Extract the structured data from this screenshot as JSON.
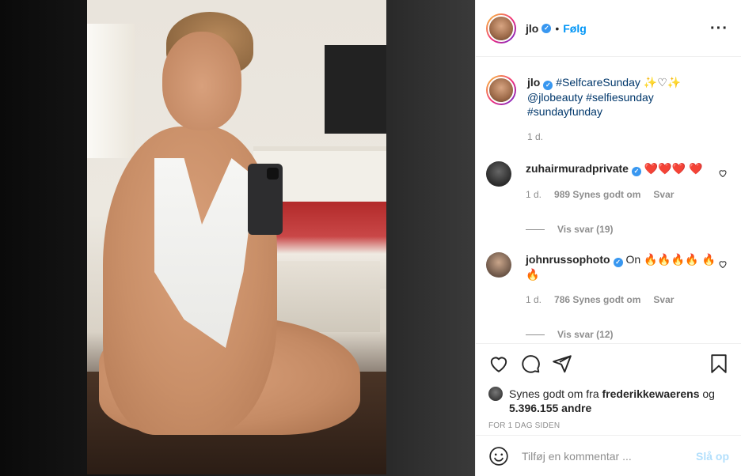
{
  "post": {
    "username": "jlo",
    "follow_label": "Følg",
    "dot": "•"
  },
  "caption": {
    "username": "jlo",
    "hashtag1": "#SelfcareSunday",
    "emoji": "✨♡✨",
    "mention": "@jlobeauty",
    "hashtag2": "#selfiesunday",
    "hashtag3": "#sundayfunday",
    "time": "1 d."
  },
  "comments": [
    {
      "username": "zuhairmuradprivate",
      "text": "❤️❤️❤️ ❤️",
      "time": "1 d.",
      "likes": "989 Synes godt om",
      "reply_label": "Svar",
      "view_replies": "Vis svar (19)"
    },
    {
      "username": "johnrussophoto",
      "text": "On 🔥🔥🔥🔥 🔥🔥",
      "time": "1 d.",
      "likes": "786 Synes godt om",
      "reply_label": "Svar",
      "view_replies": "Vis svar (12)"
    }
  ],
  "likes": {
    "prefix": "Synes godt om fra",
    "user": "frederikkewaerens",
    "conjunction": "og",
    "count": "5.396.155 andre"
  },
  "timestamp": "FOR 1 DAG SIDEN",
  "add_comment": {
    "placeholder": "Tilføj en kommentar ...",
    "post_label": "Slå op"
  },
  "colors": {
    "link": "#0095f6",
    "hashtag": "#00376b",
    "verified": "#3897f0",
    "muted": "#8e8e8e"
  },
  "icons": [
    "verified-badge-icon",
    "more-options-icon",
    "heart-icon",
    "comment-icon",
    "share-icon",
    "bookmark-icon",
    "emoji-icon"
  ]
}
